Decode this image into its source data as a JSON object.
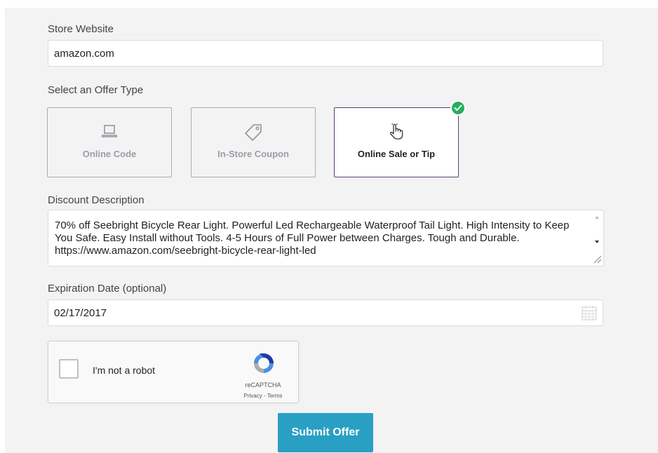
{
  "store_website": {
    "label": "Store Website",
    "value": "amazon.com"
  },
  "offer_type": {
    "label": "Select an Offer Type",
    "options": [
      {
        "label": "Online Code",
        "icon": "laptop-icon",
        "selected": false
      },
      {
        "label": "In-Store Coupon",
        "icon": "tag-icon",
        "selected": false
      },
      {
        "label": "Online Sale or Tip",
        "icon": "pointer-hand-icon",
        "selected": true
      }
    ]
  },
  "discount_description": {
    "label": "Discount Description",
    "value": "70% off Seebright Bicycle Rear Light. Powerful Led Rechargeable Waterproof Tail Light. High Intensity to Keep You Safe. Easy Install without Tools. 4-5 Hours of Full Power between Charges. Tough and Durable. https://www.amazon.com/seebright-bicycle-rear-light-led"
  },
  "expiration_date": {
    "label": "Expiration Date (optional)",
    "value": "02/17/2017",
    "icon": "calendar-icon"
  },
  "recaptcha": {
    "checkbox_label": "I'm not a robot",
    "brand": "reCAPTCHA",
    "links": "Privacy - Terms"
  },
  "submit_label": "Submit Offer",
  "colors": {
    "panel_bg": "#f3f3f3",
    "selected_border": "#5c3d6f",
    "unselected_border": "#b4a6bb",
    "check_green": "#27ae60",
    "submit_bg": "#2a9fc4"
  }
}
